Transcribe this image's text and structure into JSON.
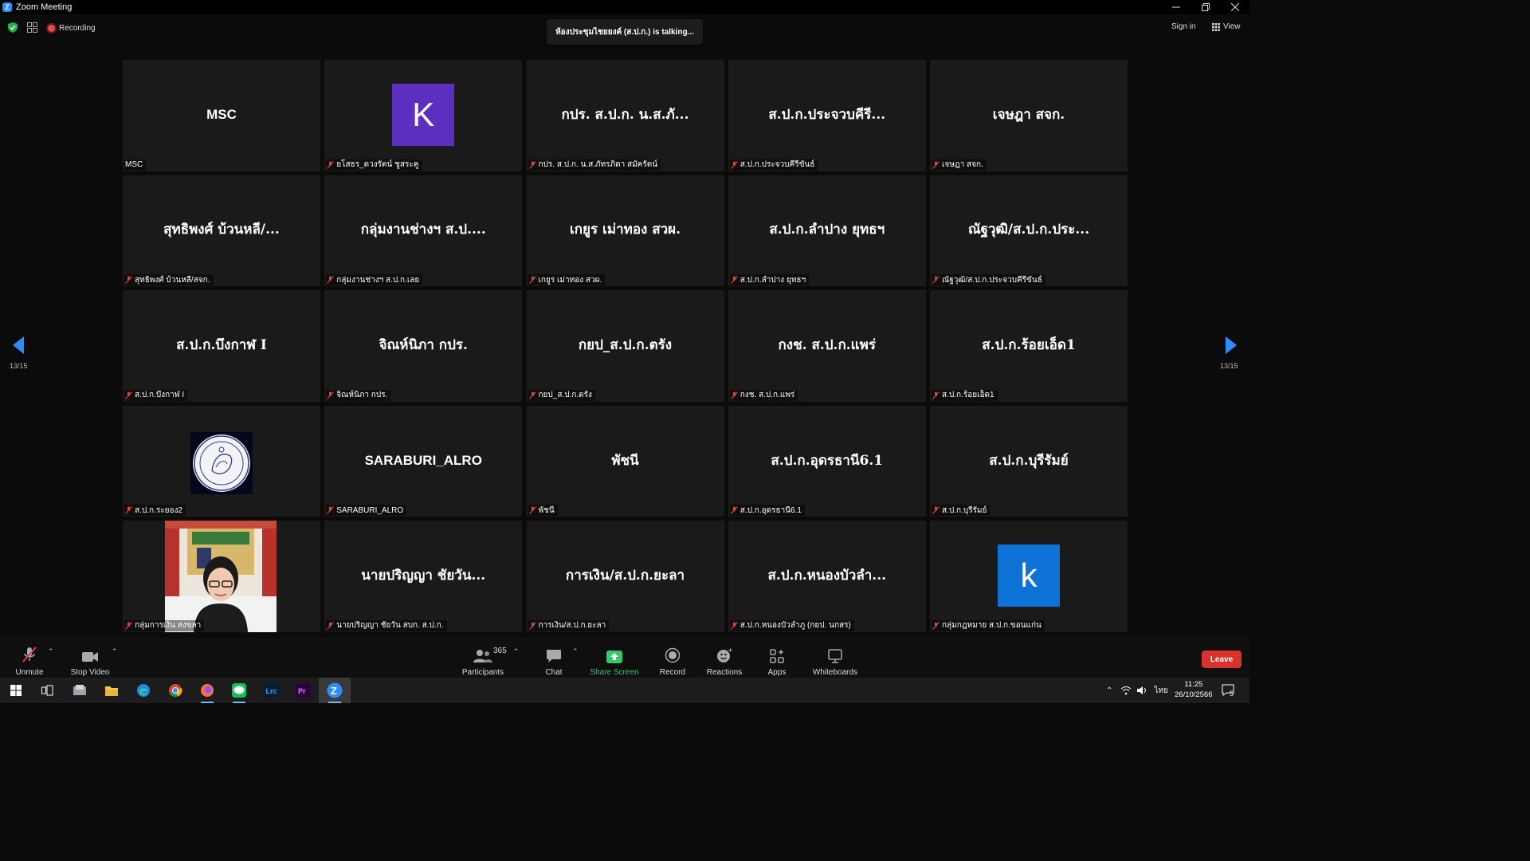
{
  "window": {
    "title": "Zoom Meeting"
  },
  "topbar": {
    "recording_label": "Recording",
    "talking_banner": "ห้องประชุมไชยยงค์ (ส.ป.ก.) is  talking...",
    "signin_label": "Sign in",
    "view_label": "View"
  },
  "pagination": {
    "left": "13/15",
    "right": "13/15"
  },
  "tiles": [
    {
      "display": "MSC",
      "label": "MSC",
      "muted": false
    },
    {
      "display": "K",
      "label": "ยโสธร_ดวงรัตน์ ชูสระคู",
      "muted": true
    },
    {
      "display": "กปร. ส.ป.ก. น.ส.ภั...",
      "label": "กปร. ส.ป.ก. น.ส.ภัทรภิดา สมัครัตน์",
      "muted": true
    },
    {
      "display": "ส.ป.ก.ประจวบคีรี...",
      "label": "ส.ป.ก.ประจวบคีรีขันธ์",
      "muted": true
    },
    {
      "display": "เจษฎา สจก.",
      "label": "เจษฎา สจก.",
      "muted": true
    },
    {
      "display": "สุทธิพงศ์  บ้วนหลี/...",
      "label": "สุทธิพงศ์  บ้วนหลี/สจก.",
      "muted": true
    },
    {
      "display": "กลุ่มงานช่างฯ ส.ป....",
      "label": "กลุ่มงานช่างฯ ส.ป.ก.เลย",
      "muted": true
    },
    {
      "display": "เกยูร เม่าทอง สวผ.",
      "label": "เกยูร เม่าทอง สวผ.",
      "muted": true
    },
    {
      "display": "ส.ป.ก.ลำปาง ยุทธฯ",
      "label": "ส.ป.ก.ลำปาง ยุทธฯ",
      "muted": true
    },
    {
      "display": "ณัฐวุฒิ/ส.ป.ก.ประ...",
      "label": "ณัฐวุฒิ/ส.ป.ก.ประจวบคีรีขันธ์",
      "muted": true
    },
    {
      "display": "ส.ป.ก.บึงกาฬ I",
      "label": "ส.ป.ก.บึงกาฬ I",
      "muted": true
    },
    {
      "display": "จิณห์นิภา กปร.",
      "label": "จิณห์นิภา กปร.",
      "muted": true
    },
    {
      "display": "กยป_ส.ป.ก.ตรัง",
      "label": "กยป_ส.ป.ก.ตรัง",
      "muted": true
    },
    {
      "display": "กงช. ส.ป.ก.แพร่",
      "label": "กงช. ส.ป.ก.แพร่",
      "muted": true
    },
    {
      "display": "ส.ป.ก.ร้อยเอ็ด1",
      "label": "ส.ป.ก.ร้อยเอ็ด1",
      "muted": true
    },
    {
      "display": "",
      "label": "ส.ป.ก.ระยอง2",
      "muted": true
    },
    {
      "display": "SARABURI_ALRO",
      "label": "SARABURI_ALRO",
      "muted": true
    },
    {
      "display": "พัชนี",
      "label": "พัชนี",
      "muted": true
    },
    {
      "display": "ส.ป.ก.อุดรธานี6.1",
      "label": "ส.ป.ก.อุดรธานี6.1",
      "muted": true
    },
    {
      "display": "ส.ป.ก.บุรีรัมย์",
      "label": "ส.ป.ก.บุรีรัมย์",
      "muted": true
    },
    {
      "display": "",
      "label": "กลุ่มการเงิน สงขลา",
      "muted": true
    },
    {
      "display": "นายปริญญา ชัยวัน...",
      "label": "นายปริญญา ชัยวัน สบก. ส.ป.ก.",
      "muted": true
    },
    {
      "display": "การเงิน/ส.ป.ก.ยะลา",
      "label": "การเงิน/ส.ป.ก.ยะลา",
      "muted": true
    },
    {
      "display": "ส.ป.ก.หนองบัวลำ...",
      "label": "ส.ป.ก.หนองบัวลำภู (กยป. นกสร)",
      "muted": true
    },
    {
      "display": "k",
      "label": "กลุ่มกฎหมาย ส.ป.ก.ขอนแก่น",
      "muted": true
    }
  ],
  "toolbar": {
    "unmute": "Unmute",
    "stop_video": "Stop Video",
    "participants": "Participants",
    "participants_count": "365",
    "chat": "Chat",
    "share_screen": "Share Screen",
    "record": "Record",
    "reactions": "Reactions",
    "apps": "Apps",
    "whiteboards": "Whiteboards",
    "leave": "Leave"
  },
  "taskbar": {
    "lang": "ไทย",
    "time": "11:25",
    "date": "26/10/2566",
    "notifications": "5",
    "lrc_label": "Lrc",
    "pr_label": "Pr"
  },
  "colors": {
    "avatar_purple": "#5d2fc1",
    "avatar_blue": "#0e72d6",
    "share_green": "#35c76a",
    "leave_red": "#d9322a",
    "arrow_blue": "#2d8cff"
  }
}
